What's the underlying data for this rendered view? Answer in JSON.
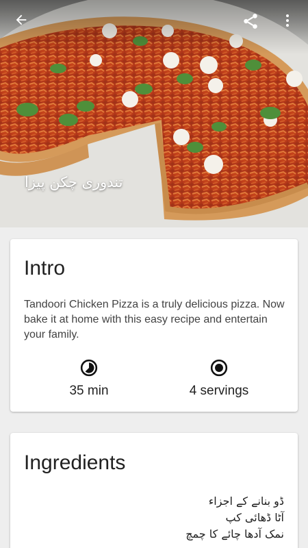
{
  "hero": {
    "title": "تندوری چکن پیزا"
  },
  "toolbar": {
    "icons": [
      "back-arrow-icon",
      "share-icon",
      "more-vert-icon"
    ]
  },
  "intro": {
    "heading": "Intro",
    "description": "Tandoori Chicken Pizza is a truly delicious pizza. Now bake it at home with this easy recipe and entertain your family.",
    "time": {
      "icon": "clock-icon",
      "value": "35 min"
    },
    "servings": {
      "icon": "servings-icon",
      "value": "4 servings"
    }
  },
  "ingredients": {
    "heading": "Ingredients",
    "lines": [
      "ڈو بنانے کے اجزاء",
      "آٹا ڈھائی کپ",
      "نمک آدھا چائے کا چمچ"
    ]
  }
}
